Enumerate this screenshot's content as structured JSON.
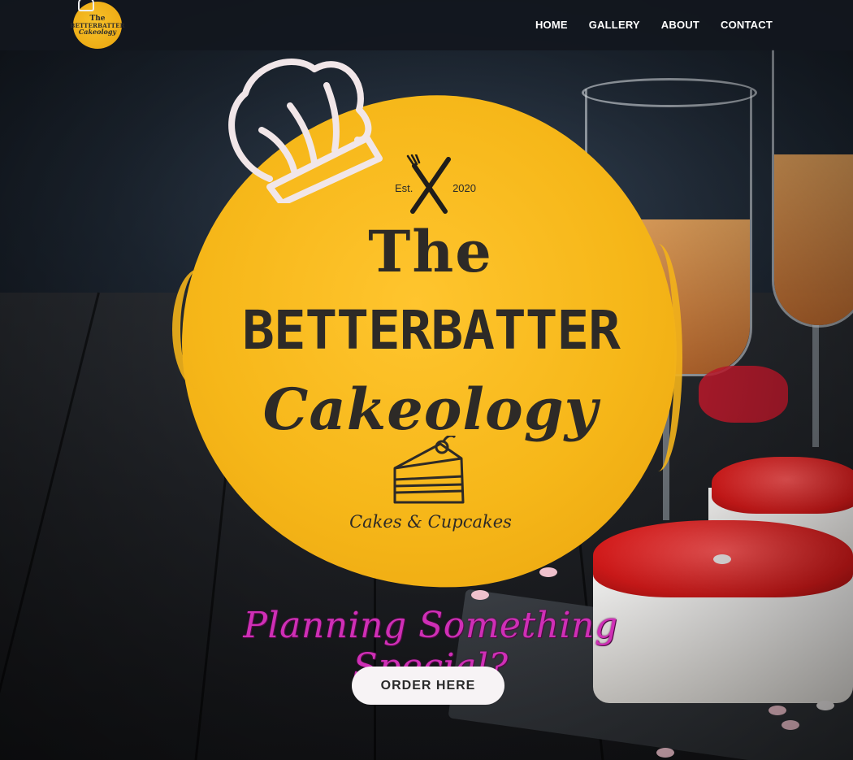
{
  "nav": {
    "logo": {
      "line1": "The",
      "line2": "BETTERBATTER",
      "line3": "Cakeology"
    },
    "items": [
      {
        "label": "HOME"
      },
      {
        "label": "GALLERY"
      },
      {
        "label": "ABOUT"
      },
      {
        "label": "CONTACT"
      }
    ]
  },
  "hero_logo": {
    "est_label": "Est.",
    "est_year": "2020",
    "title_the": "The",
    "title_brand": "BETTERBATTER",
    "title_cakeology": "Cakeology",
    "subtitle": "Cakes & Cupcakes",
    "icons": [
      "chef-hat-icon",
      "fork-knife-icon",
      "cake-slice-icon"
    ]
  },
  "hero": {
    "tagline": "Planning Something Special?",
    "cta_label": "ORDER HERE"
  },
  "colors": {
    "nav_bg": "#12171e",
    "logo_yellow": "#f6b719",
    "logo_ink": "#2d2a27",
    "tagline": "#cf2fb6",
    "cta_bg": "#f7f3f5"
  }
}
